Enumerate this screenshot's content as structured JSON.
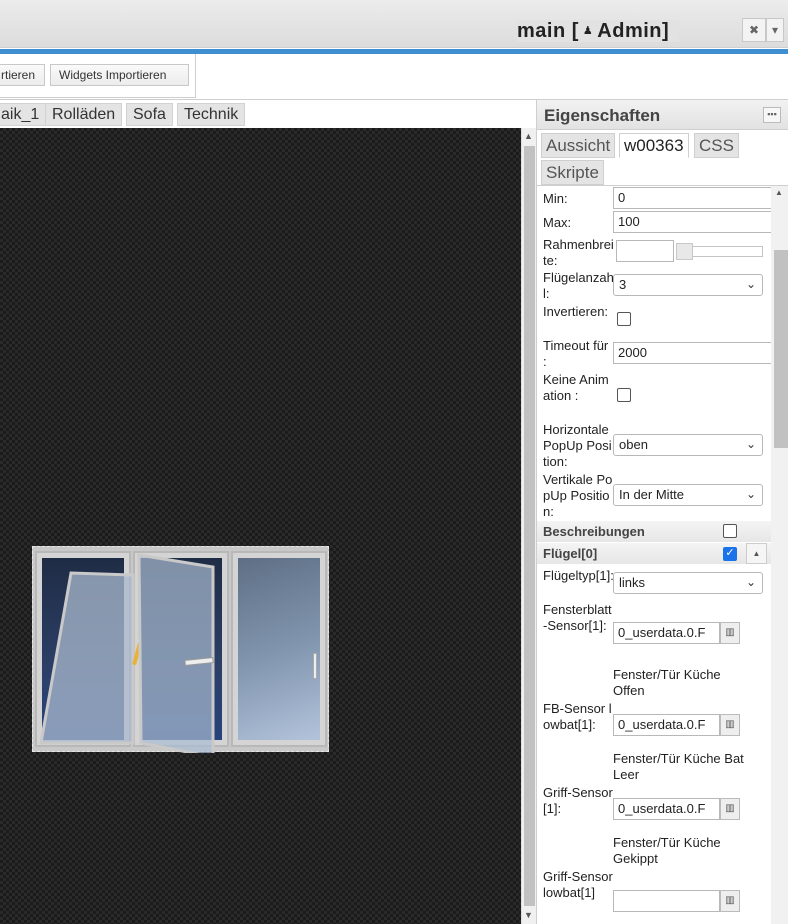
{
  "title_bar": {
    "project_prefix": "main [",
    "user": "Admin]",
    "user_icon": "user-icon",
    "close_icon": "✖",
    "dropdown_icon": "▾"
  },
  "toolbar": {
    "export_label": "Widgets Exportieren",
    "export_visible": "rtieren",
    "import_label": "Widgets Importieren"
  },
  "view_tabs": [
    "aik_1",
    "Rolläden",
    "Sofa",
    "Technik"
  ],
  "properties": {
    "title": "Eigenschaften",
    "collapse_icon": "▪▪▪",
    "tabs": [
      "Aussicht",
      "w00363",
      "CSS",
      "Skripte"
    ],
    "active_tab": "w00363",
    "fields": {
      "min_label": "Min:",
      "min_value": "0",
      "max_label": "Max:",
      "max_value": "100",
      "frame_label": "Rahmenbreite:",
      "frame_value": "",
      "leaf_count_label": "Flügelanzahl:",
      "leaf_count_value": "3",
      "invert_label": "Invertieren:",
      "invert_checked": false,
      "timeout_label": "Timeout für :",
      "timeout_value": "2000",
      "no_anim_label": "Keine Animation :",
      "no_anim_checked": false,
      "h_popup_label": "Horizontale PopUp Position:",
      "h_popup_value": "oben",
      "v_popup_label": "Vertikale PopUp Position:",
      "v_popup_value": "In der Mitte"
    },
    "sections": {
      "descriptions_label": "Beschreibungen",
      "descriptions_checked": false,
      "leaf_label": "Flügel[0]",
      "leaf_checked": true
    },
    "leaf_fields": {
      "type_label": "Flügeltyp[1]:",
      "type_value": "links",
      "sensor_label": "Fensterblatt-Sensor[1]:",
      "sensor_value": "0_userdata.0.F",
      "sensor_desc": "Fenster/Tür Küche Offen",
      "fb_label": "FB-Sensor lowbat[1]:",
      "fb_value": "0_userdata.0.F",
      "fb_desc": "Fenster/Tür Küche Bat Leer",
      "handle_label": "Griff-Sensor[1]:",
      "handle_value": "0_userdata.0.F",
      "handle_desc": "Fenster/Tür Küche Gekippt",
      "handle_lowbat_label": "Griff-Sensor lowbat[1]",
      "handle_lowbat_value": ""
    },
    "chevron": "⌄",
    "pick_icon": "▥"
  },
  "colors": {
    "accent_blue": "#3d8fd1",
    "checkbox_blue": "#1a73e8"
  }
}
